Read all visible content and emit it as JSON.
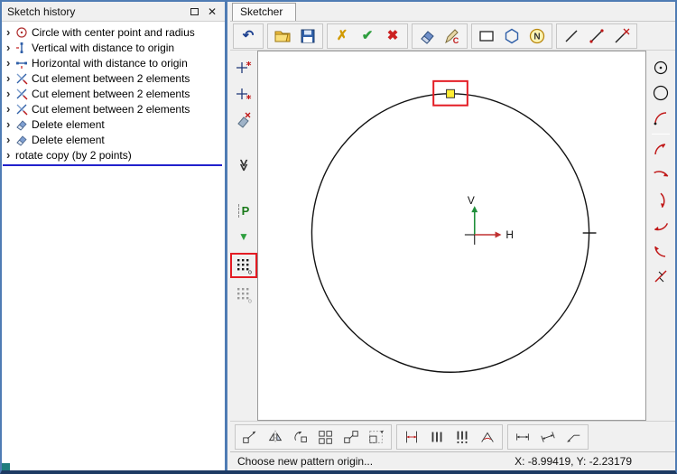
{
  "glyphs": {
    "chevron": "›",
    "close": "✕",
    "undo": "↶",
    "discard": "✗",
    "accept": "✔",
    "cancel": "✖",
    "collapse": "≫",
    "letter_c": "C",
    "letter_n": "N",
    "letter_p": "P",
    "insert_triangle": "▼",
    "sub_o": "o"
  },
  "history": {
    "title": "Sketch history",
    "items": [
      {
        "label": "Circle with center point and radius",
        "icon": "circle-radius-icon"
      },
      {
        "label": "Vertical with distance to origin",
        "icon": "vertical-distance-icon"
      },
      {
        "label": "Horizontal with distance to origin",
        "icon": "horizontal-distance-icon"
      },
      {
        "label": "Cut element between 2 elements",
        "icon": "cut-element-icon"
      },
      {
        "label": "Cut element between 2 elements",
        "icon": "cut-element-icon"
      },
      {
        "label": "Cut element between 2 elements",
        "icon": "cut-element-icon"
      },
      {
        "label": "Delete element",
        "icon": "delete-element-icon"
      },
      {
        "label": "Delete element",
        "icon": "delete-element-icon"
      },
      {
        "label": "rotate copy (by 2 points)",
        "icon": "none"
      }
    ]
  },
  "sketcher": {
    "title": "Sketcher",
    "axis": {
      "v": "V",
      "h": "H"
    },
    "status": {
      "message": "Choose new pattern origin...",
      "coordinates": "X: -8.99419, Y: -2.23179"
    }
  },
  "toolbars": {
    "top": [
      "undo",
      "open",
      "save",
      "discard",
      "accept",
      "cancel",
      "eraser",
      "edit-copy",
      "rectangle",
      "polygon",
      "nurbs-circle",
      "line",
      "line-points",
      "line-delete"
    ],
    "left": [
      "point",
      "point-constraint",
      "delete-point",
      "collapse",
      "pattern-p",
      "insert-marker",
      "pattern-grid",
      "pattern-grid-alt"
    ],
    "right": [
      "circle-center",
      "circle",
      "arc-vertex",
      "arc-1",
      "arc-2",
      "arc-3",
      "arc-4",
      "arc-5",
      "red-line"
    ],
    "bottom": [
      "move",
      "mirror",
      "rotate",
      "array",
      "array-move",
      "scale",
      "distance",
      "parallel-lines",
      "parallel-points",
      "angle",
      "dimension-h",
      "dimension-aligned",
      "leader"
    ]
  },
  "colors": {
    "highlight_red": "#e31b23",
    "insert_line_blue": "#2121cc",
    "point_yellow": "#ffee33",
    "axis_green": "#1f8f3a",
    "axis_red": "#c03030"
  }
}
